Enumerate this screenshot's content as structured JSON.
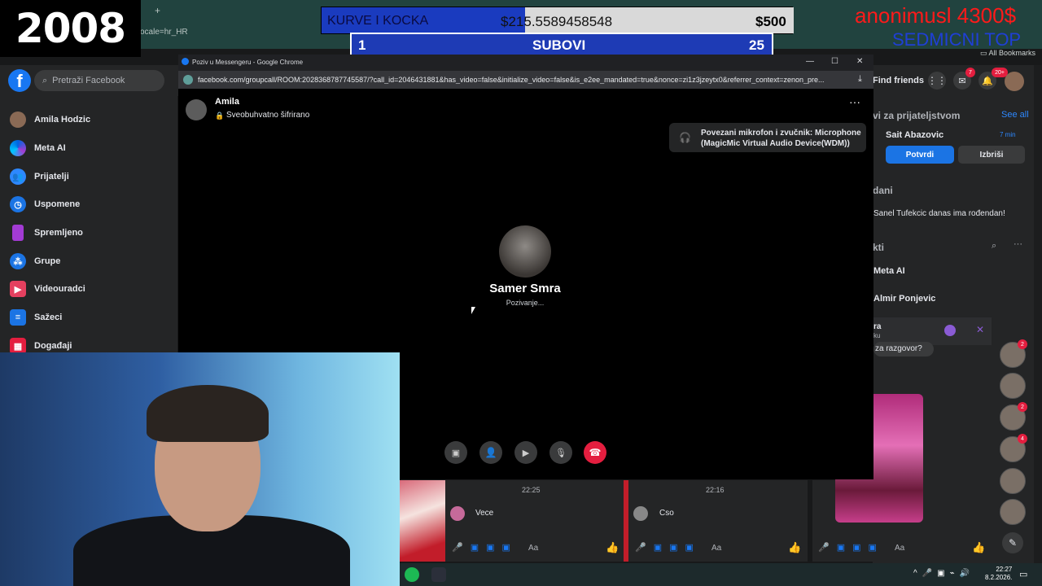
{
  "overlay": {
    "year": "2008",
    "score_name": "KURVE I KOCKA",
    "score_value": "$215.5589458548",
    "score_amount": "$500",
    "score_left": "1",
    "score_center": "SUBOVI",
    "score_right": "25",
    "red_text": "anonimusl 4300$",
    "blue_text": "SEDMICNI TOP"
  },
  "browser_bg": {
    "url_fragment": "ocale=hr_HR",
    "bookmarks_label": "All Bookmarks",
    "new_tab": "+"
  },
  "popup": {
    "title": "Poziv u Messengeru - Google Chrome",
    "url": "facebook.com/groupcall/ROOM:2028368787745587/?call_id=2046431881&has_video=false&initialize_video=false&is_e2ee_mandated=true&nonce=zi1z3jzeytx0&referrer_context=zenon_pre...",
    "call_title": "Amila",
    "encryption": "Sveobuhvatno šifrirano",
    "toast": "Povezani mikrofon i zvučnik: Microphone (MagicMic Virtual Audio Device(WDM))",
    "callee_name": "Samer Smra",
    "callee_status": "Pozivanje..."
  },
  "fb": {
    "search_placeholder": "Pretraži Facebook",
    "find_friends": "Find friends",
    "messenger_badge": "7",
    "notif_badge": "20+",
    "left_nav": [
      {
        "label": "Amila Hodzic",
        "icon": "avatar"
      },
      {
        "label": "Meta AI",
        "icon": "meta-ai-icon"
      },
      {
        "label": "Prijatelji",
        "icon": "friends-icon"
      },
      {
        "label": "Uspomene",
        "icon": "memories-icon"
      },
      {
        "label": "Spremljeno",
        "icon": "saved-icon"
      },
      {
        "label": "Grupe",
        "icon": "groups-icon"
      },
      {
        "label": "Videouradci",
        "icon": "video-icon"
      },
      {
        "label": "Sažeci",
        "icon": "feeds-icon"
      },
      {
        "label": "Događaji",
        "icon": "events-icon"
      }
    ],
    "right": {
      "friend_requests_title": "vi za prijateljstvom",
      "see_all": "See all",
      "requester": "Sait Abazovic",
      "request_time": "7 min",
      "confirm": "Potvrdi",
      "delete": "Izbriši",
      "birthdays_title": "dani",
      "birthday_text": "Sanel Tufekcic danas ima rođendan!",
      "contacts_title": "kti",
      "contacts": [
        "Meta AI",
        "Almir Ponjevic"
      ],
      "chat_preview_name": "ra",
      "chat_preview_sub": "ku",
      "chat_preview_msg": "za razgovor?"
    },
    "chatheads_badges": [
      "2",
      "2",
      "4"
    ]
  },
  "chats": [
    {
      "time": "22:25",
      "message": "Vece",
      "input": "Aa"
    },
    {
      "time": "22:16",
      "message": "Cso",
      "input": "Aa"
    },
    {
      "time": "",
      "message": "",
      "input": "Aa"
    }
  ],
  "taskbar": {
    "time": "22:27",
    "date": "8.2.2026."
  }
}
